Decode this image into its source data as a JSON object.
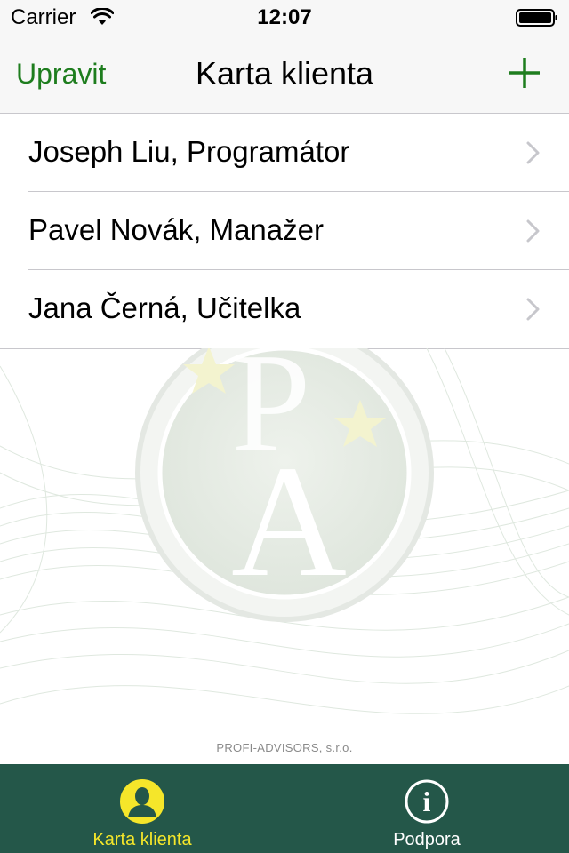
{
  "status_bar": {
    "carrier": "Carrier",
    "time": "12:07",
    "icons": [
      "wifi-icon",
      "battery-icon"
    ]
  },
  "nav": {
    "edit_label": "Upravit",
    "title": "Karta klienta",
    "add_icon": "plus-icon",
    "accent_color": "#1e7d1e"
  },
  "clients": [
    {
      "label": "Joseph Liu, Programátor"
    },
    {
      "label": "Pavel Novák, Manažer"
    },
    {
      "label": "Jana Černá, Učitelka"
    }
  ],
  "background": {
    "logo_letters": "PA",
    "company": "PROFI-ADVISORS, s.r.o."
  },
  "tab_bar": {
    "background_color": "#245749",
    "tabs": [
      {
        "label": "Karta klienta",
        "icon": "person-icon",
        "selected": true,
        "color": "#f5e62a"
      },
      {
        "label": "Podpora",
        "icon": "info-icon",
        "selected": false,
        "color": "#ffffff"
      }
    ]
  }
}
